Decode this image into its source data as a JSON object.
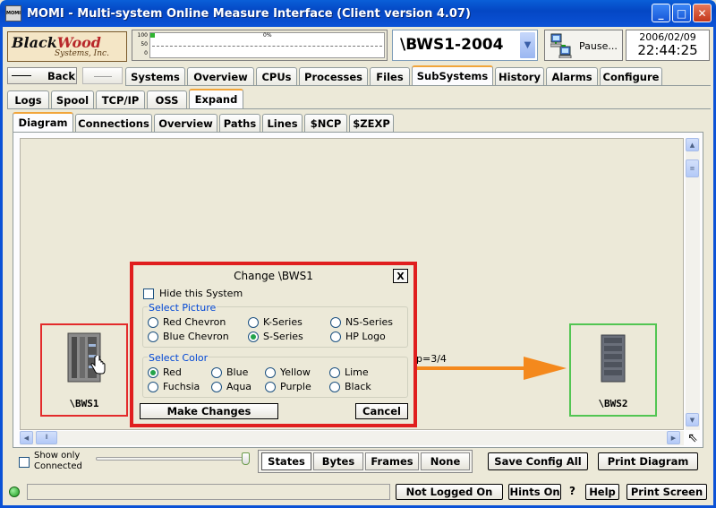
{
  "window": {
    "title": "MOMI - Multi-system Online Measure Interface (Client version 4.07)",
    "icon_text": "MOMI",
    "controls": [
      "minimize-icon",
      "maximize-icon",
      "close-icon"
    ]
  },
  "header": {
    "logo_line1_a": "Black",
    "logo_line1_b": "Wood",
    "logo_line2": "Systems, Inc.",
    "meter_scale": [
      "100",
      "50",
      "0"
    ],
    "meter_label": "0%",
    "meter_level_percent": 2,
    "system_value": "\\BWS1-2004",
    "pause_label": "Pause...",
    "date": "2006/02/09",
    "time": "22:44:25"
  },
  "nav": {
    "back_label": "Back",
    "main_tabs": [
      "Systems",
      "Overview",
      "CPUs",
      "Processes",
      "Files",
      "SubSystems",
      "History",
      "Alarms",
      "Configure"
    ],
    "main_active": "SubSystems",
    "sub_tabs": [
      "Logs",
      "Spool",
      "TCP/IP",
      "OSS",
      "Expand"
    ],
    "sub_active": "Expand",
    "view_tabs": [
      "Diagram",
      "Connections",
      "Overview",
      "Paths",
      "Lines",
      "$NCP",
      "$ZEXP"
    ],
    "view_active": "Diagram"
  },
  "diagram": {
    "node1_name": "\\BWS1",
    "node2_name": "\\BWS2",
    "link_label": "p=3/4",
    "colors": {
      "node1": "#e32b2b",
      "node2": "#52c552",
      "link": "#f4891d"
    }
  },
  "dialog": {
    "title": "Change \\BWS1",
    "close_label": "X",
    "hide_label": "Hide this System",
    "picture_group": "Select Picture",
    "picture_options": [
      "Red Chevron",
      "K-Series",
      "NS-Series",
      "Blue Chevron",
      "S-Series",
      "HP Logo"
    ],
    "picture_selected": "S-Series",
    "color_group": "Select Color",
    "color_options": [
      "Red",
      "Blue",
      "Yellow",
      "Lime",
      "Fuchsia",
      "Aqua",
      "Purple",
      "Black"
    ],
    "color_selected": "Red",
    "make_changes_label": "Make Changes",
    "cancel_label": "Cancel"
  },
  "bottom": {
    "show_only_line1": "Show only",
    "show_only_line2": "Connected",
    "modes": [
      "States",
      "Bytes",
      "Frames",
      "None"
    ],
    "mode_selected": "States",
    "save_config_label": "Save Config All",
    "print_diagram_label": "Print Diagram"
  },
  "status": {
    "not_logged_label": "Not Logged On",
    "hints_label": "Hints On",
    "question": "?",
    "help_label": "Help",
    "print_screen_label": "Print Screen"
  }
}
